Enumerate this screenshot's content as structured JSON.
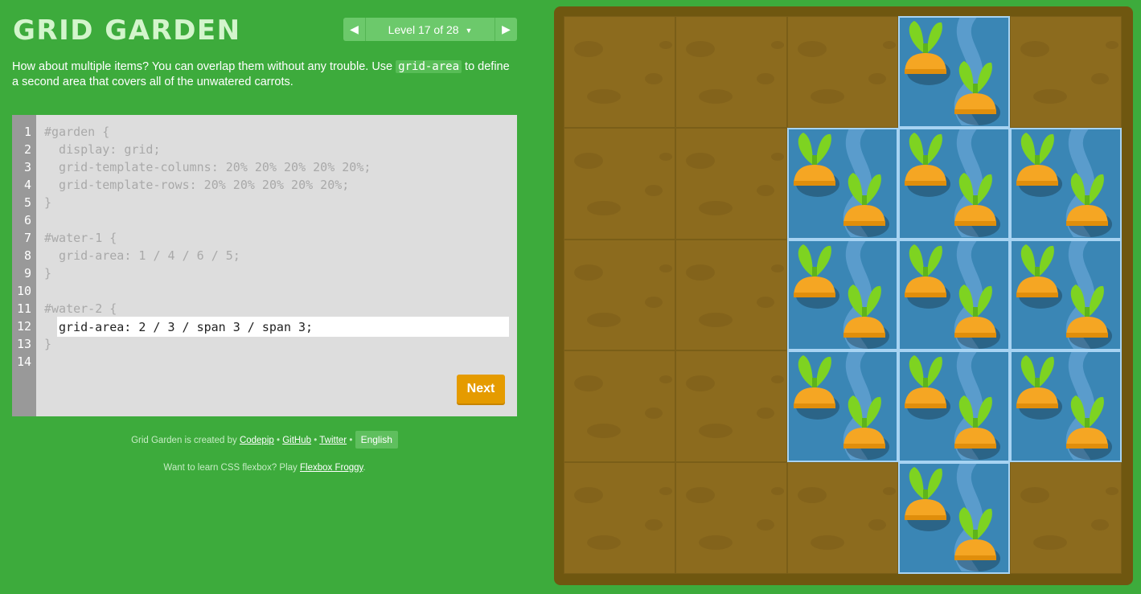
{
  "app": {
    "title": "GRID GARDEN"
  },
  "level_nav": {
    "label": "Level 17 of 28",
    "prev_icon": "triangle-left-icon",
    "next_icon": "triangle-right-icon",
    "menu_icon": "caret-down-icon"
  },
  "instructions": {
    "before": "How about multiple items? You can overlap them without any trouble. Use ",
    "code": "grid-area",
    "after": " to define a second area that covers all of the unwatered carrots."
  },
  "editor": {
    "line_numbers": [
      "1",
      "2",
      "3",
      "4",
      "5",
      "6",
      "7",
      "8",
      "9",
      "10",
      "11",
      "12",
      "13",
      "14"
    ],
    "lines": [
      "#garden {",
      "  display: grid;",
      "  grid-template-columns: 20% 20% 20% 20% 20%;",
      "  grid-template-rows: 20% 20% 20% 20% 20%;",
      "}",
      "",
      "#water-1 {",
      "  grid-area: 1 / 4 / 6 / 5;",
      "}",
      "",
      "#water-2 {",
      "",
      "}",
      ""
    ],
    "input_value": "grid-area: 2 / 3 / span 3 / span 3;",
    "next_label": "Next"
  },
  "credits": {
    "prefix": "Grid Garden is created by",
    "codepip": "Codepip",
    "sep1": "•",
    "github": "GitHub",
    "sep2": "•",
    "twitter": "Twitter",
    "sep3": "•",
    "language": "English"
  },
  "promo": {
    "prefix": "Want to learn CSS flexbox? Play",
    "link": "Flexbox Froggy",
    "suffix": "."
  },
  "garden": {
    "rows": [
      [
        "dirt",
        "dirt",
        "dirt",
        "water",
        "dirt"
      ],
      [
        "dirt",
        "dirt",
        "water",
        "water",
        "water"
      ],
      [
        "dirt",
        "dirt",
        "water",
        "water",
        "water"
      ],
      [
        "dirt",
        "dirt",
        "water",
        "water",
        "water"
      ],
      [
        "dirt",
        "dirt",
        "dirt",
        "water",
        "dirt"
      ]
    ],
    "colors": {
      "dirt": "#8c6b1e",
      "water": "#3a86b5",
      "carrot": "#f5a623",
      "leaf": "#7ed321"
    },
    "icon": "carrot-icon"
  }
}
